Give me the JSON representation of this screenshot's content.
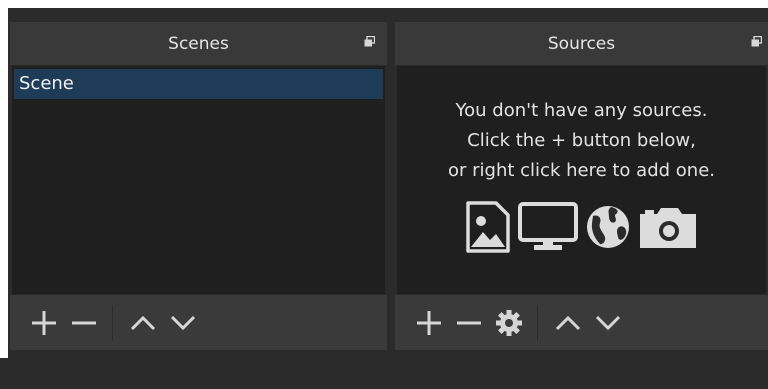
{
  "scenes_dock": {
    "title": "Scenes",
    "items": [
      {
        "label": "Scene",
        "selected": true
      }
    ]
  },
  "sources_dock": {
    "title": "Sources",
    "empty_message_lines": [
      "You don't have any sources.",
      "Click the + button below,",
      "or right click here to add one."
    ],
    "hint_icons": [
      "image-icon",
      "display-icon",
      "globe-icon",
      "camera-icon"
    ]
  },
  "colors": {
    "selection": "#1e3b57",
    "panel_bg": "#1f1f1f",
    "header_bg": "#393939",
    "toolbar_bg": "#3a3a3a"
  }
}
